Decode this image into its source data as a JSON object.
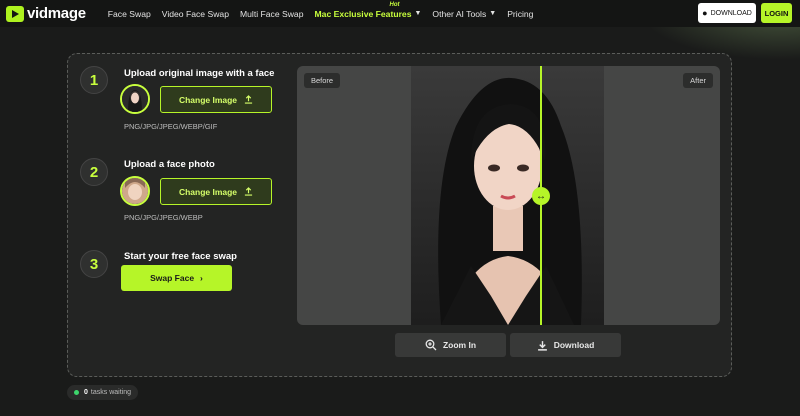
{
  "brand": {
    "name": "vidmage"
  },
  "nav": {
    "items": [
      {
        "label": "Face Swap"
      },
      {
        "label": "Video Face Swap"
      },
      {
        "label": "Multi Face Swap"
      },
      {
        "label": "Mac Exclusive Features",
        "badge": "Hot"
      },
      {
        "label": "Other AI Tools"
      },
      {
        "label": "Pricing"
      }
    ]
  },
  "header": {
    "download_label": "DOWNLOAD",
    "login_label": "LOGIN"
  },
  "steps": [
    {
      "number": "1",
      "title": "Upload original image with a face",
      "button": "Change Image",
      "formats": "PNG/JPG/JPEG/WEBP/GIF"
    },
    {
      "number": "2",
      "title": "Upload a face photo",
      "button": "Change Image",
      "formats": "PNG/JPG/JPEG/WEBP"
    },
    {
      "number": "3",
      "title": "Start your free face swap",
      "button": "Swap Face"
    }
  ],
  "preview": {
    "before_label": "Before",
    "after_label": "After"
  },
  "actions": {
    "zoom_label": "Zoom In",
    "download_label": "Download"
  },
  "tasks": {
    "count": "0",
    "label": "tasks waiting"
  },
  "colors": {
    "accent": "#b6f528",
    "background": "#1a1b1a",
    "panel": "#232423"
  },
  "icons": [
    "logo-icon",
    "chevron-down-icon",
    "apple-icon",
    "upload-icon",
    "arrow-right-icon",
    "zoom-in-icon",
    "download-icon",
    "swap-handle-icon"
  ]
}
